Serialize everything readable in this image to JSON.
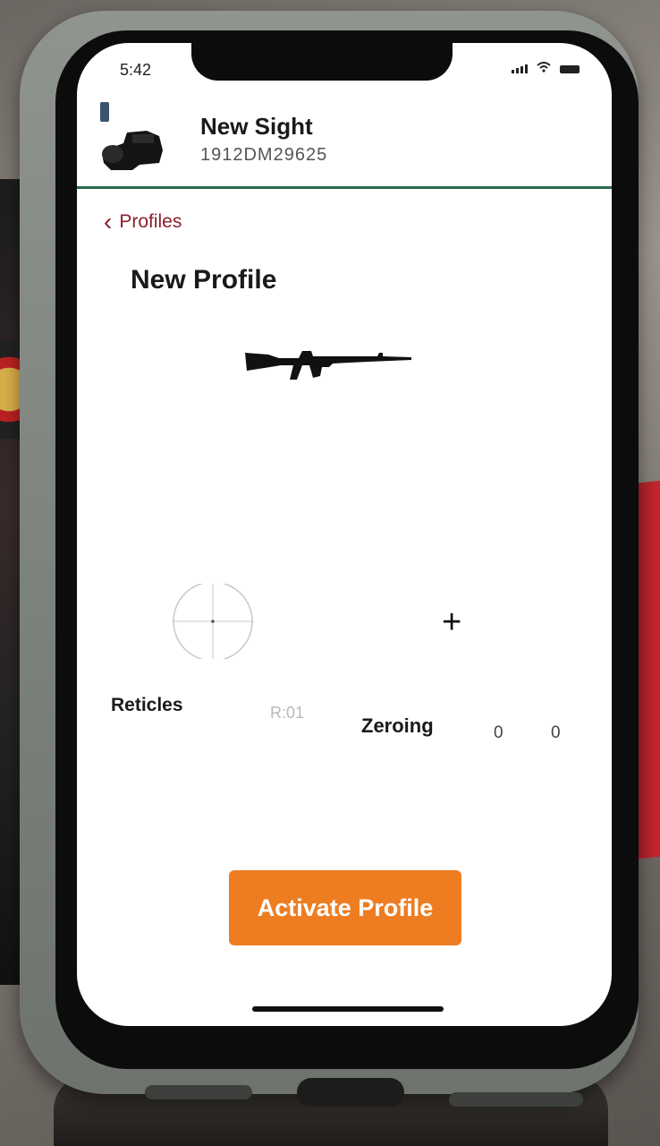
{
  "status_bar": {
    "time": "5:42"
  },
  "header": {
    "device_name": "New Sight",
    "device_serial": "1912DM29625"
  },
  "nav": {
    "back_label": "Profiles"
  },
  "profile": {
    "title": "New Profile",
    "reticles_label": "Reticles",
    "reticle_value": "R:01",
    "zeroing_label": "Zeroing",
    "zero_x": "0",
    "zero_y": "0"
  },
  "actions": {
    "activate_label": "Activate Profile"
  },
  "colors": {
    "accent": "#ee7d22",
    "divider": "#2d6a4f",
    "back_link": "#8b1e2b"
  },
  "icons": [
    "battery-icon",
    "wifi-icon",
    "signal-icon",
    "device-image",
    "chevron-left-icon",
    "rifle-icon",
    "reticle-icon",
    "plus-icon"
  ]
}
